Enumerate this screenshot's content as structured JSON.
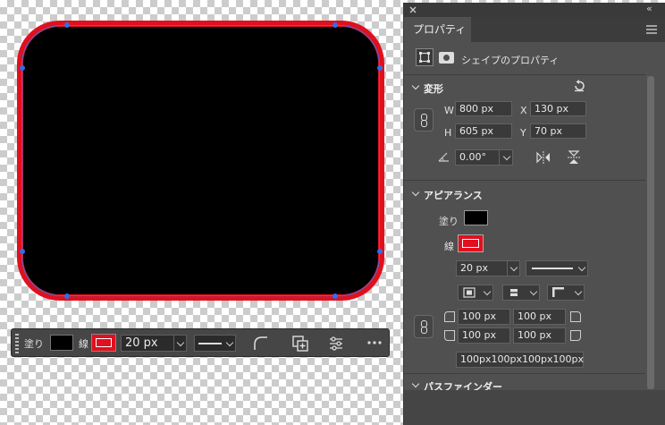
{
  "canvas": {
    "shape_fill": "#000000",
    "shape_stroke": "#e0101e",
    "anchor_color": "#2f6ee8"
  },
  "taskbar": {
    "fill_label": "塗り",
    "stroke_label": "線",
    "stroke_width": "20 px"
  },
  "panel": {
    "tab_title": "プロパティ",
    "shape_props_label": "シェイプのプロパティ",
    "transform": {
      "header": "変形",
      "w_label": "W",
      "w_value": "800 px",
      "x_label": "X",
      "x_value": "130 px",
      "h_label": "H",
      "h_value": "605 px",
      "y_label": "Y",
      "y_value": "70 px",
      "angle_value": "0.00°"
    },
    "appearance": {
      "header": "アピアランス",
      "fill_label": "塗り",
      "stroke_label": "線",
      "stroke_width": "20 px",
      "corner_tl": "100 px",
      "corner_tr": "100 px",
      "corner_bl": "100 px",
      "corner_br": "100 px",
      "corners_combined": "100px100px100px100px"
    },
    "next_section": "パスファインダー"
  },
  "colors": {
    "accent_stroke": "#e0101e",
    "panel_bg": "#505050"
  }
}
